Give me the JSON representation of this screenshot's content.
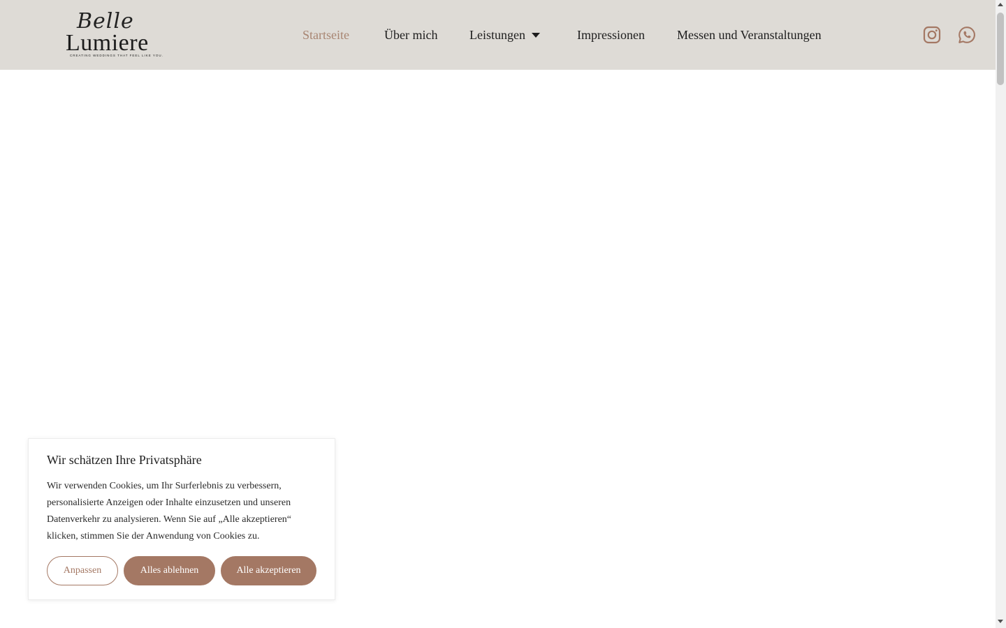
{
  "brand": {
    "logo_script": "Belle",
    "logo_main": "Lumiere",
    "tagline": "CREATING WEDDINGS THAT FEEL LIKE YOU."
  },
  "nav": {
    "items": [
      {
        "label": "Startseite",
        "active": true
      },
      {
        "label": "Über mich",
        "active": false
      },
      {
        "label": "Leistungen",
        "active": false,
        "has_dropdown": true
      },
      {
        "label": "Impressionen",
        "active": false
      },
      {
        "label": "Messen und Veranstaltungen",
        "active": false
      }
    ]
  },
  "social": {
    "icons": [
      "instagram-icon",
      "whatsapp-icon"
    ]
  },
  "cookie_banner": {
    "title": "Wir schätzen Ihre Privatsphäre",
    "text": "Wir verwenden Cookies, um Ihr Surferlebnis zu verbessern, personalisierte Anzeigen oder Inhalte einzusetzen und unseren Datenverkehr zu analysieren. Wenn Sie auf „Alle akzeptieren“ klicken, stimmen Sie der Anwendung von Cookies zu.",
    "buttons": {
      "customize": "Anpassen",
      "reject": "Alles ablehnen",
      "accept": "Alle akzeptieren"
    }
  },
  "colors": {
    "header_bg": "#dedbd6",
    "accent": "#a47864",
    "active_nav": "#a88572",
    "text": "#1d1d1d"
  }
}
